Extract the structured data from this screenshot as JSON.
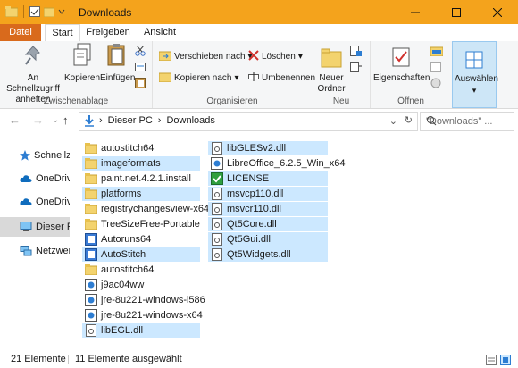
{
  "window": {
    "title": "Downloads"
  },
  "tabs": [
    "Datei",
    "Start",
    "Freigeben",
    "Ansicht"
  ],
  "ribbon": {
    "clipboard": {
      "pin_label": "An Schnellzugriff anheften",
      "copy_label": "Kopieren",
      "paste_label": "Einfügen",
      "group_label": "Zwischenablage"
    },
    "organize": {
      "move_label": "Verschieben nach",
      "copy_to_label": "Kopieren nach",
      "delete_label": "Löschen",
      "rename_label": "Umbenennen",
      "group_label": "Organisieren"
    },
    "new": {
      "new_folder_label": "Neuer Ordner",
      "group_label": "Neu"
    },
    "open": {
      "properties_label": "Eigenschaften",
      "group_label": "Öffnen"
    },
    "select": {
      "select_label": "Auswählen"
    }
  },
  "address": {
    "crumbs": [
      "Dieser PC",
      "Downloads"
    ],
    "search_placeholder": "\"Downloads\" ..."
  },
  "nav": [
    {
      "label": "Schnellzu",
      "icon": "star-icon"
    },
    {
      "label": "OneDrive",
      "icon": "cloud-icon"
    },
    {
      "label": "OneDrive",
      "icon": "cloud-icon"
    },
    {
      "label": "Dieser PC",
      "icon": "computer-icon"
    },
    {
      "label": "Netzwerk",
      "icon": "network-icon"
    }
  ],
  "files_col1": [
    {
      "name": "autostitch64",
      "icon": "folder-icon",
      "selected": false
    },
    {
      "name": "imageformats",
      "icon": "folder-icon",
      "selected": true
    },
    {
      "name": "paint.net.4.2.1.install",
      "icon": "folder-icon",
      "selected": false
    },
    {
      "name": "platforms",
      "icon": "folder-icon",
      "selected": true
    },
    {
      "name": "registrychangesview-x64",
      "icon": "folder-icon",
      "selected": false
    },
    {
      "name": "TreeSizeFree-Portable",
      "icon": "folder-icon",
      "selected": false
    },
    {
      "name": "Autoruns64",
      "icon": "app-icon",
      "selected": false
    },
    {
      "name": "AutoStitch",
      "icon": "app-icon",
      "selected": true
    },
    {
      "name": "autostitch64",
      "icon": "folder-icon",
      "selected": false
    },
    {
      "name": "j9ac04ww",
      "icon": "setup-icon",
      "selected": false
    },
    {
      "name": "jre-8u221-windows-i586",
      "icon": "setup-icon",
      "selected": false
    },
    {
      "name": "jre-8u221-windows-x64",
      "icon": "setup-icon",
      "selected": false
    },
    {
      "name": "libEGL.dll",
      "icon": "dll-icon",
      "selected": true
    }
  ],
  "files_col2": [
    {
      "name": "libGLESv2.dll",
      "icon": "dll-icon",
      "selected": true
    },
    {
      "name": "LibreOffice_6.2.5_Win_x64",
      "icon": "setup-icon",
      "selected": false
    },
    {
      "name": "LICENSE",
      "icon": "license-icon",
      "selected": true
    },
    {
      "name": "msvcp110.dll",
      "icon": "dll-icon",
      "selected": true
    },
    {
      "name": "msvcr110.dll",
      "icon": "dll-icon",
      "selected": true
    },
    {
      "name": "Qt5Core.dll",
      "icon": "dll-icon",
      "selected": true
    },
    {
      "name": "Qt5Gui.dll",
      "icon": "dll-icon",
      "selected": true
    },
    {
      "name": "Qt5Widgets.dll",
      "icon": "dll-icon",
      "selected": true
    }
  ],
  "status": {
    "count": "21 Elemente",
    "selected": "11 Elemente ausgewählt"
  }
}
